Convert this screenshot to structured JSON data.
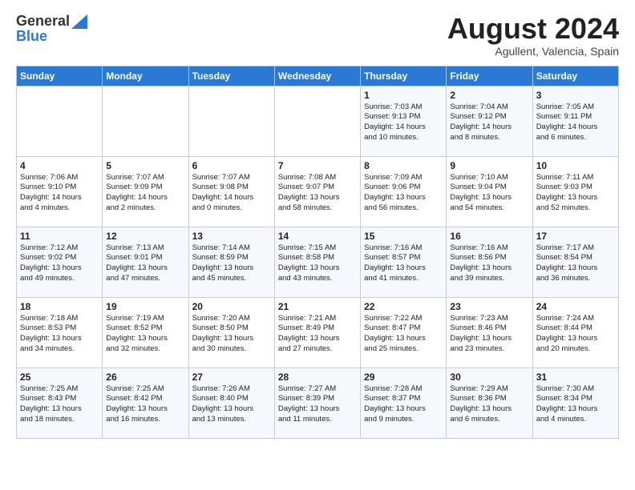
{
  "header": {
    "logo_line1": "General",
    "logo_line2": "Blue",
    "month_title": "August 2024",
    "location": "Agullent, Valencia, Spain"
  },
  "days_of_week": [
    "Sunday",
    "Monday",
    "Tuesday",
    "Wednesday",
    "Thursday",
    "Friday",
    "Saturday"
  ],
  "weeks": [
    [
      {
        "day": "",
        "content": ""
      },
      {
        "day": "",
        "content": ""
      },
      {
        "day": "",
        "content": ""
      },
      {
        "day": "",
        "content": ""
      },
      {
        "day": "1",
        "content": "Sunrise: 7:03 AM\nSunset: 9:13 PM\nDaylight: 14 hours\nand 10 minutes."
      },
      {
        "day": "2",
        "content": "Sunrise: 7:04 AM\nSunset: 9:12 PM\nDaylight: 14 hours\nand 8 minutes."
      },
      {
        "day": "3",
        "content": "Sunrise: 7:05 AM\nSunset: 9:11 PM\nDaylight: 14 hours\nand 6 minutes."
      }
    ],
    [
      {
        "day": "4",
        "content": "Sunrise: 7:06 AM\nSunset: 9:10 PM\nDaylight: 14 hours\nand 4 minutes."
      },
      {
        "day": "5",
        "content": "Sunrise: 7:07 AM\nSunset: 9:09 PM\nDaylight: 14 hours\nand 2 minutes."
      },
      {
        "day": "6",
        "content": "Sunrise: 7:07 AM\nSunset: 9:08 PM\nDaylight: 14 hours\nand 0 minutes."
      },
      {
        "day": "7",
        "content": "Sunrise: 7:08 AM\nSunset: 9:07 PM\nDaylight: 13 hours\nand 58 minutes."
      },
      {
        "day": "8",
        "content": "Sunrise: 7:09 AM\nSunset: 9:06 PM\nDaylight: 13 hours\nand 56 minutes."
      },
      {
        "day": "9",
        "content": "Sunrise: 7:10 AM\nSunset: 9:04 PM\nDaylight: 13 hours\nand 54 minutes."
      },
      {
        "day": "10",
        "content": "Sunrise: 7:11 AM\nSunset: 9:03 PM\nDaylight: 13 hours\nand 52 minutes."
      }
    ],
    [
      {
        "day": "11",
        "content": "Sunrise: 7:12 AM\nSunset: 9:02 PM\nDaylight: 13 hours\nand 49 minutes."
      },
      {
        "day": "12",
        "content": "Sunrise: 7:13 AM\nSunset: 9:01 PM\nDaylight: 13 hours\nand 47 minutes."
      },
      {
        "day": "13",
        "content": "Sunrise: 7:14 AM\nSunset: 8:59 PM\nDaylight: 13 hours\nand 45 minutes."
      },
      {
        "day": "14",
        "content": "Sunrise: 7:15 AM\nSunset: 8:58 PM\nDaylight: 13 hours\nand 43 minutes."
      },
      {
        "day": "15",
        "content": "Sunrise: 7:16 AM\nSunset: 8:57 PM\nDaylight: 13 hours\nand 41 minutes."
      },
      {
        "day": "16",
        "content": "Sunrise: 7:16 AM\nSunset: 8:56 PM\nDaylight: 13 hours\nand 39 minutes."
      },
      {
        "day": "17",
        "content": "Sunrise: 7:17 AM\nSunset: 8:54 PM\nDaylight: 13 hours\nand 36 minutes."
      }
    ],
    [
      {
        "day": "18",
        "content": "Sunrise: 7:18 AM\nSunset: 8:53 PM\nDaylight: 13 hours\nand 34 minutes."
      },
      {
        "day": "19",
        "content": "Sunrise: 7:19 AM\nSunset: 8:52 PM\nDaylight: 13 hours\nand 32 minutes."
      },
      {
        "day": "20",
        "content": "Sunrise: 7:20 AM\nSunset: 8:50 PM\nDaylight: 13 hours\nand 30 minutes."
      },
      {
        "day": "21",
        "content": "Sunrise: 7:21 AM\nSunset: 8:49 PM\nDaylight: 13 hours\nand 27 minutes."
      },
      {
        "day": "22",
        "content": "Sunrise: 7:22 AM\nSunset: 8:47 PM\nDaylight: 13 hours\nand 25 minutes."
      },
      {
        "day": "23",
        "content": "Sunrise: 7:23 AM\nSunset: 8:46 PM\nDaylight: 13 hours\nand 23 minutes."
      },
      {
        "day": "24",
        "content": "Sunrise: 7:24 AM\nSunset: 8:44 PM\nDaylight: 13 hours\nand 20 minutes."
      }
    ],
    [
      {
        "day": "25",
        "content": "Sunrise: 7:25 AM\nSunset: 8:43 PM\nDaylight: 13 hours\nand 18 minutes."
      },
      {
        "day": "26",
        "content": "Sunrise: 7:25 AM\nSunset: 8:42 PM\nDaylight: 13 hours\nand 16 minutes."
      },
      {
        "day": "27",
        "content": "Sunrise: 7:26 AM\nSunset: 8:40 PM\nDaylight: 13 hours\nand 13 minutes."
      },
      {
        "day": "28",
        "content": "Sunrise: 7:27 AM\nSunset: 8:39 PM\nDaylight: 13 hours\nand 11 minutes."
      },
      {
        "day": "29",
        "content": "Sunrise: 7:28 AM\nSunset: 8:37 PM\nDaylight: 13 hours\nand 9 minutes."
      },
      {
        "day": "30",
        "content": "Sunrise: 7:29 AM\nSunset: 8:36 PM\nDaylight: 13 hours\nand 6 minutes."
      },
      {
        "day": "31",
        "content": "Sunrise: 7:30 AM\nSunset: 8:34 PM\nDaylight: 13 hours\nand 4 minutes."
      }
    ]
  ]
}
